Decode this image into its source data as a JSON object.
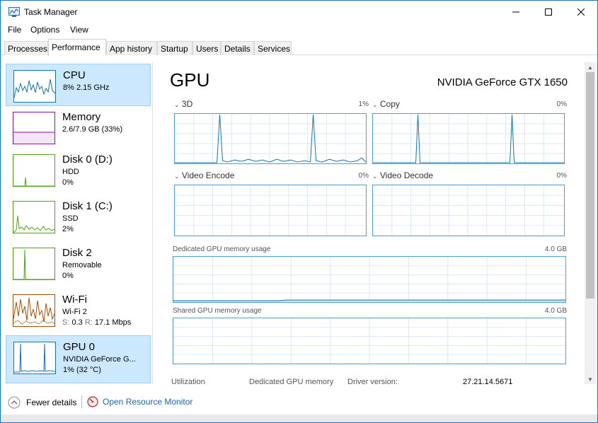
{
  "window": {
    "title": "Task Manager",
    "icons": {
      "app": "task-manager-icon",
      "minimize": "minimize-icon",
      "maximize": "maximize-icon",
      "close": "close-icon"
    }
  },
  "menu": [
    "File",
    "Options",
    "View"
  ],
  "tabs": [
    {
      "label": "Processes",
      "active": false
    },
    {
      "label": "Performance",
      "active": true
    },
    {
      "label": "App history",
      "active": false
    },
    {
      "label": "Startup",
      "active": false
    },
    {
      "label": "Users",
      "active": false
    },
    {
      "label": "Details",
      "active": false
    },
    {
      "label": "Services",
      "active": false
    }
  ],
  "sidebar": {
    "cpu": {
      "title": "CPU",
      "line1": "8% 2.15 GHz"
    },
    "memory": {
      "title": "Memory",
      "line1": "2.6/7.9 GB (33%)"
    },
    "disk0": {
      "title": "Disk 0 (D:)",
      "line1": "HDD",
      "line2": "0%"
    },
    "disk1": {
      "title": "Disk 1 (C:)",
      "line1": "SSD",
      "line2": "2%"
    },
    "disk2": {
      "title": "Disk 2",
      "line1": "Removable",
      "line2": "0%"
    },
    "wifi": {
      "title": "Wi-Fi",
      "line1": "Wi-Fi 2",
      "send_label": "S:",
      "send_value": "0.3",
      "recv_label": "R:",
      "recv_value": "17.1 Mbps"
    },
    "gpu0": {
      "title": "GPU 0",
      "line1": "NVIDIA GeForce G...",
      "line2": "1% (32 °C)"
    },
    "colors": {
      "cpu": "#1174b5",
      "memory": "#8b12ae",
      "disk": "#4da60c",
      "wifi": "#a74f01",
      "gpu": "#1174b5"
    }
  },
  "main": {
    "heading": "GPU",
    "model": "NVIDIA GeForce GTX 1650",
    "engines": {
      "e3d": {
        "label": "3D",
        "pct": "1%"
      },
      "copy": {
        "label": "Copy",
        "pct": "0%"
      },
      "video_encode": {
        "label": "Video Encode",
        "pct": "0%"
      },
      "video_decode": {
        "label": "Video Decode",
        "pct": "0%"
      }
    },
    "dedicated": {
      "label": "Dedicated GPU memory usage",
      "max": "4.0 GB"
    },
    "shared": {
      "label": "Shared GPU memory usage",
      "max": "4.0 GB"
    },
    "stats": {
      "utilization_label": "Utilization",
      "dedicated_label": "Dedicated GPU memory",
      "driver_label": "Driver version:",
      "driver_value": "27.21.14.5671"
    },
    "accent": "#1174b5"
  },
  "footer": {
    "fewer_details": "Fewer details",
    "resource_monitor": "Open Resource Monitor",
    "icons": {
      "fewer": "chevron-up-icon",
      "monitor": "resource-monitor-icon"
    }
  }
}
